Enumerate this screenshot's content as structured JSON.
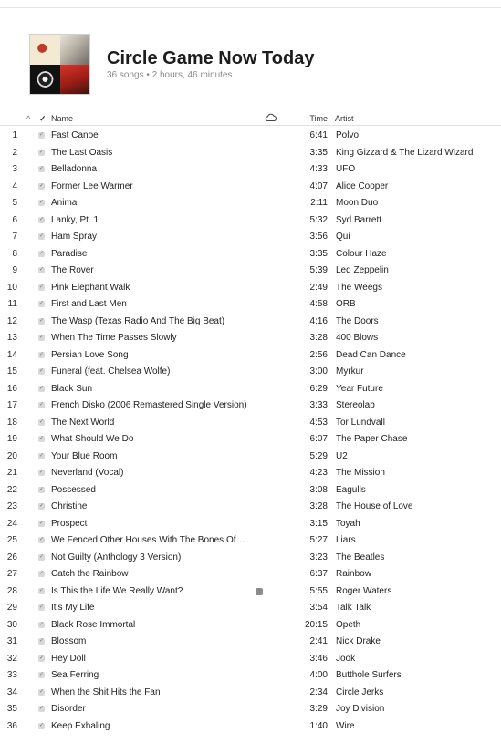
{
  "playlist": {
    "title": "Circle Game Now Today",
    "subtitle": "36 songs • 2 hours, 46 minutes"
  },
  "columns": {
    "sort_indicator": "^",
    "check": "✓",
    "name": "Name",
    "time": "Time",
    "artist": "Artist"
  },
  "tracks": [
    {
      "num": "1",
      "name": "Fast Canoe",
      "time": "6:41",
      "artist": "Polvo"
    },
    {
      "num": "2",
      "name": "The Last Oasis",
      "time": "3:35",
      "artist": "King Gizzard & The Lizard Wizard"
    },
    {
      "num": "3",
      "name": "Belladonna",
      "time": "4:33",
      "artist": "UFO"
    },
    {
      "num": "4",
      "name": "Former Lee Warmer",
      "time": "4:07",
      "artist": "Alice Cooper"
    },
    {
      "num": "5",
      "name": "Animal",
      "time": "2:11",
      "artist": "Moon Duo"
    },
    {
      "num": "6",
      "name": "Lanky, Pt. 1",
      "time": "5:32",
      "artist": "Syd Barrett"
    },
    {
      "num": "7",
      "name": "Ham Spray",
      "time": "3:56",
      "artist": "Qui"
    },
    {
      "num": "8",
      "name": "Paradise",
      "time": "3:35",
      "artist": "Colour Haze"
    },
    {
      "num": "9",
      "name": "The Rover",
      "time": "5:39",
      "artist": "Led Zeppelin"
    },
    {
      "num": "10",
      "name": "Pink Elephant Walk",
      "time": "2:49",
      "artist": "The Weegs"
    },
    {
      "num": "11",
      "name": "First and Last Men",
      "time": "4:58",
      "artist": "ORB"
    },
    {
      "num": "12",
      "name": "The Wasp (Texas Radio And The Big Beat)",
      "time": "4:16",
      "artist": "The Doors"
    },
    {
      "num": "13",
      "name": "When The Time Passes Slowly",
      "time": "3:28",
      "artist": "400 Blows"
    },
    {
      "num": "14",
      "name": "Persian Love Song",
      "time": "2:56",
      "artist": "Dead Can Dance"
    },
    {
      "num": "15",
      "name": "Funeral (feat. Chelsea Wolfe)",
      "time": "3:00",
      "artist": "Myrkur"
    },
    {
      "num": "16",
      "name": "Black Sun",
      "time": "6:29",
      "artist": "Year Future"
    },
    {
      "num": "17",
      "name": "French Disko (2006 Remastered Single Version)",
      "time": "3:33",
      "artist": "Stereolab"
    },
    {
      "num": "18",
      "name": "The Next World",
      "time": "4:53",
      "artist": "Tor Lundvall"
    },
    {
      "num": "19",
      "name": "What Should We Do",
      "time": "6:07",
      "artist": "The Paper Chase"
    },
    {
      "num": "20",
      "name": "Your Blue Room",
      "time": "5:29",
      "artist": "U2"
    },
    {
      "num": "21",
      "name": "Neverland (Vocal)",
      "time": "4:23",
      "artist": "The Mission"
    },
    {
      "num": "22",
      "name": "Possessed",
      "time": "3:08",
      "artist": "Eagulls"
    },
    {
      "num": "23",
      "name": "Christine",
      "time": "3:28",
      "artist": "The House of Love"
    },
    {
      "num": "24",
      "name": "Prospect",
      "time": "3:15",
      "artist": "Toyah"
    },
    {
      "num": "25",
      "name": "We Fenced Other Houses With The Bones Of…",
      "time": "5:27",
      "artist": "Liars"
    },
    {
      "num": "26",
      "name": "Not Guilty (Anthology 3 Version)",
      "time": "3:23",
      "artist": "The Beatles"
    },
    {
      "num": "27",
      "name": "Catch the Rainbow",
      "time": "6:37",
      "artist": "Rainbow"
    },
    {
      "num": "28",
      "name": "Is This the Life We Really Want?",
      "time": "5:55",
      "artist": "Roger Waters",
      "explicit": true
    },
    {
      "num": "29",
      "name": "It's My Life",
      "time": "3:54",
      "artist": "Talk Talk"
    },
    {
      "num": "30",
      "name": "Black Rose Immortal",
      "time": "20:15",
      "artist": "Opeth"
    },
    {
      "num": "31",
      "name": "Blossom",
      "time": "2:41",
      "artist": "Nick Drake"
    },
    {
      "num": "32",
      "name": "Hey Doll",
      "time": "3:46",
      "artist": "Jook"
    },
    {
      "num": "33",
      "name": "Sea Ferring",
      "time": "4:00",
      "artist": "Butthole Surfers"
    },
    {
      "num": "34",
      "name": "When the Shit Hits the Fan",
      "time": "2:34",
      "artist": "Circle Jerks"
    },
    {
      "num": "35",
      "name": "Disorder",
      "time": "3:29",
      "artist": "Joy Division"
    },
    {
      "num": "36",
      "name": "Keep Exhaling",
      "time": "1:40",
      "artist": "Wire"
    }
  ],
  "icons": {
    "cloud_column": "cloud-icon",
    "checkbox": "checkbox-checked-icon",
    "explicit": "explicit-badge-icon"
  },
  "colors": {
    "text": "#1f1f1f",
    "muted": "#8a8a8a",
    "checkbox": "#d9d9d9"
  }
}
